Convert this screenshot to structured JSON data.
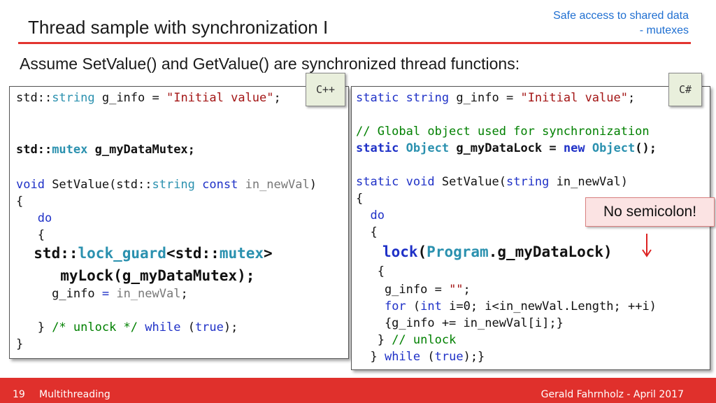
{
  "header": {
    "title": "Thread sample with synchronization I",
    "topic_line1": "Safe access to shared data",
    "topic_line2": "- mutexes"
  },
  "subtitle": "Assume SetValue() and  GetValue() are synchronized thread functions:",
  "tags": {
    "cpp": "C++",
    "csharp": "C#"
  },
  "callout": "No semicolon!",
  "cpp_code": [
    [
      [
        "",
        "std::"
      ],
      [
        "ty",
        "string"
      ],
      [
        "",
        " g_info = "
      ],
      [
        "str",
        "\"Initial value\""
      ],
      [
        "",
        ";"
      ]
    ],
    [],
    [
      [
        "b",
        "std::"
      ],
      [
        "b ty",
        "mutex"
      ],
      [
        "b",
        " g_myDataMutex;"
      ]
    ],
    [],
    [
      [
        "kw",
        "void"
      ],
      [
        "",
        " SetValue(std::"
      ],
      [
        "ty",
        "string"
      ],
      [
        "",
        " "
      ],
      [
        "kw",
        "const"
      ],
      [
        "",
        " "
      ],
      [
        "gr",
        "in_newVal"
      ],
      [
        "",
        ")"
      ]
    ],
    [
      [
        "",
        "{"
      ]
    ],
    [
      [
        "",
        "   "
      ],
      [
        "kw",
        "do"
      ]
    ],
    [
      [
        "",
        "   {"
      ]
    ],
    [
      [
        "big",
        "  std::"
      ],
      [
        "big ty",
        "lock_guard"
      ],
      [
        "big",
        "<std::"
      ],
      [
        "big ty",
        "mutex"
      ],
      [
        "big",
        ">"
      ]
    ],
    [
      [
        "big",
        "     myLock(g_myDataMutex);"
      ]
    ],
    [
      [
        "",
        "     g_info "
      ],
      [
        "kw",
        "="
      ],
      [
        "",
        " "
      ],
      [
        "gr",
        "in_newVal"
      ],
      [
        "",
        ";"
      ]
    ],
    [],
    [
      [
        "",
        "   } "
      ],
      [
        "cm",
        "/* unlock */"
      ],
      [
        "",
        " "
      ],
      [
        "kw",
        "while"
      ],
      [
        "",
        " ("
      ],
      [
        "kw",
        "true"
      ],
      [
        "",
        ");"
      ]
    ],
    [
      [
        "",
        "}"
      ]
    ]
  ],
  "csharp_code": [
    [
      [
        "kw",
        "static"
      ],
      [
        "",
        " "
      ],
      [
        "kw",
        "string"
      ],
      [
        "",
        " g_info = "
      ],
      [
        "str",
        "\"Initial value\""
      ],
      [
        "",
        ";"
      ]
    ],
    [],
    [
      [
        "cm",
        "// Global object used for synchronization"
      ]
    ],
    [
      [
        "b kw",
        "static"
      ],
      [
        "b",
        " "
      ],
      [
        "b ty",
        "Object"
      ],
      [
        "b",
        " g_myDataLock = "
      ],
      [
        "b kw",
        "new"
      ],
      [
        "b",
        " "
      ],
      [
        "b ty",
        "Object"
      ],
      [
        "b",
        "();"
      ]
    ],
    [],
    [
      [
        "kw",
        "static"
      ],
      [
        "",
        " "
      ],
      [
        "kw",
        "void"
      ],
      [
        "",
        " SetValue("
      ],
      [
        "kw",
        "string"
      ],
      [
        "",
        " in_newVal)"
      ]
    ],
    [
      [
        "",
        "{"
      ]
    ],
    [
      [
        "",
        "  "
      ],
      [
        "kw",
        "do"
      ]
    ],
    [
      [
        "",
        "  {"
      ]
    ],
    [
      [
        "big",
        "   "
      ],
      [
        "big kw",
        "lock"
      ],
      [
        "big",
        "("
      ],
      [
        "big ty",
        "Program"
      ],
      [
        "big",
        ".g_myDataLock)"
      ]
    ],
    [
      [
        "",
        "   {"
      ]
    ],
    [
      [
        "",
        "    g_info = "
      ],
      [
        "str",
        "\"\""
      ],
      [
        "",
        ";"
      ]
    ],
    [
      [
        "",
        "    "
      ],
      [
        "kw",
        "for"
      ],
      [
        "",
        " ("
      ],
      [
        "kw",
        "int"
      ],
      [
        "",
        " i=0; i<in_newVal.Length; ++i)"
      ]
    ],
    [
      [
        "",
        "    {g_info += in_newVal[i];}"
      ]
    ],
    [
      [
        "",
        "   } "
      ],
      [
        "cm",
        "// unlock"
      ]
    ],
    [
      [
        "",
        "  } "
      ],
      [
        "kw",
        "while"
      ],
      [
        "",
        " ("
      ],
      [
        "kw",
        "true"
      ],
      [
        "",
        ");}"
      ]
    ]
  ],
  "footer": {
    "page_number": "19",
    "section": "Multithreading",
    "author_date": "Gerald Fahrnholz - April 2017"
  }
}
